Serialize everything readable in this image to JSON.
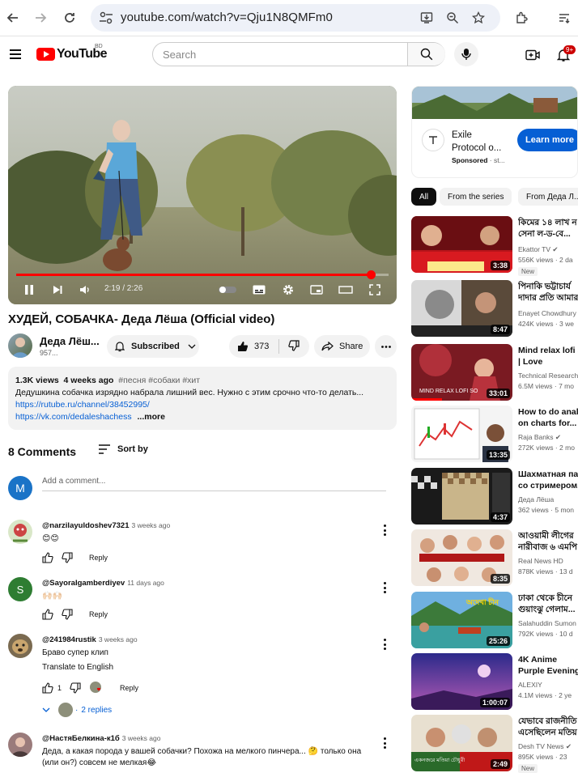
{
  "browser": {
    "url": "youtube.com/watch?v=Qju1N8QMFm0"
  },
  "header": {
    "logo_text": "YouTube",
    "country": "BD",
    "search_placeholder": "Search",
    "notifications": "9+"
  },
  "player": {
    "time": "2:19 / 2:26",
    "progress": 0.952
  },
  "video": {
    "title": "ХУДЕЙ, СОБАЧКА- Деда Лёша (Official video)",
    "channel": "Деда Лёш...",
    "subscribers": "957...",
    "subscribed_label": "Subscribed",
    "likes": "373",
    "share_label": "Share"
  },
  "description": {
    "views": "1.3K views",
    "date": "4 weeks ago",
    "tags": "#песня #собаки #хит",
    "text": "Дедушкина собачка изрядно набрала лишний вес. Нужно с этим срочно что-то делать...",
    "link1": "https://rutube.ru/channel/38452995/",
    "link2": "https://vk.com/dedaleshachess",
    "more": "...more"
  },
  "comments": {
    "header": "8 Comments",
    "sort_label": "Sort by",
    "my_initial": "M",
    "add_placeholder": "Add a comment...",
    "reply_label": "Reply",
    "items": [
      {
        "author": "@narzilayuldoshev7321",
        "when": "3 weeks ago",
        "text": "😊😊",
        "likes": ""
      },
      {
        "author": "@SayoraIgamberdiyev",
        "when": "11 days ago",
        "text": "🙌🏻🙌🏻",
        "likes": "",
        "initial": "S"
      },
      {
        "author": "@241984rustik",
        "when": "3 weeks ago",
        "text": "Браво супер клип",
        "translate": "Translate to English",
        "likes": "1",
        "replies": "2 replies"
      },
      {
        "author": "@НастяБелкина-к1б",
        "when": "3 weeks ago",
        "text": "Деда, а какая порода у вашей собачки? Похожа на мелкого пинчера... 🤔 только она (или он?) совсем не мелкая😂",
        "likes": ""
      }
    ]
  },
  "ad": {
    "title": "Exile Protocol o...",
    "sponsored": "Sponsored",
    "source": "· st...",
    "cta": "Learn more"
  },
  "chips": [
    "All",
    "From the series",
    "From Деда Л..."
  ],
  "recommendations": [
    {
      "title": "কিমের ১৪ লাখ ন সেনা ল-ড-বে...",
      "channel": "Ekattor TV",
      "stats": "556K views · 2 da",
      "badge": "New",
      "duration": "3:38"
    },
    {
      "title": "পিনাকি ভট্টাচার্য দাদার প্রতি আমার",
      "channel": "Enayet Chowdhury",
      "stats": "424K views · 3 we",
      "duration": "8:47"
    },
    {
      "title": "Mind relax lofi s | Love mashup...",
      "channel": "Technical Research",
      "stats": "6.5M views · 7 mo",
      "duration": "33:01"
    },
    {
      "title": "How to do analy on charts for...",
      "channel": "Raja Banks",
      "stats": "272K views · 2 mo",
      "duration": "13:35"
    },
    {
      "title": "Шахматная пар со стримером...",
      "channel": "Деда Лёша",
      "stats": "362 views · 5 mon",
      "duration": "4:37"
    },
    {
      "title": "আওয়ামী লীগের নারীবাজ ৬ এমপি",
      "channel": "Real News HD",
      "stats": "878K views · 13 d",
      "duration": "8:35"
    },
    {
      "title": "ঢাকা থেকে চীনে গুয়াংঝু গেলাম...",
      "channel": "Salahuddin Sumon",
      "stats": "792K views · 10 d",
      "duration": "25:26"
    },
    {
      "title": "4K Anime Purple Evening Sky -...",
      "channel": "ALEXIY",
      "stats": "4.1M views · 2 ye",
      "duration": "1:00:07"
    },
    {
      "title": "যেভাবে রাজনীতি এসেছিলেন মতিয়",
      "channel": "Desh TV News",
      "stats": "895K views · 23",
      "badge": "New",
      "duration": "2:49"
    }
  ],
  "thumb_texts": {
    "t3": "MIND RELAX LOFI SO",
    "t6": "অদেখা চীন",
    "t9": "একনজরে মতিয়া চৌধুরী"
  }
}
